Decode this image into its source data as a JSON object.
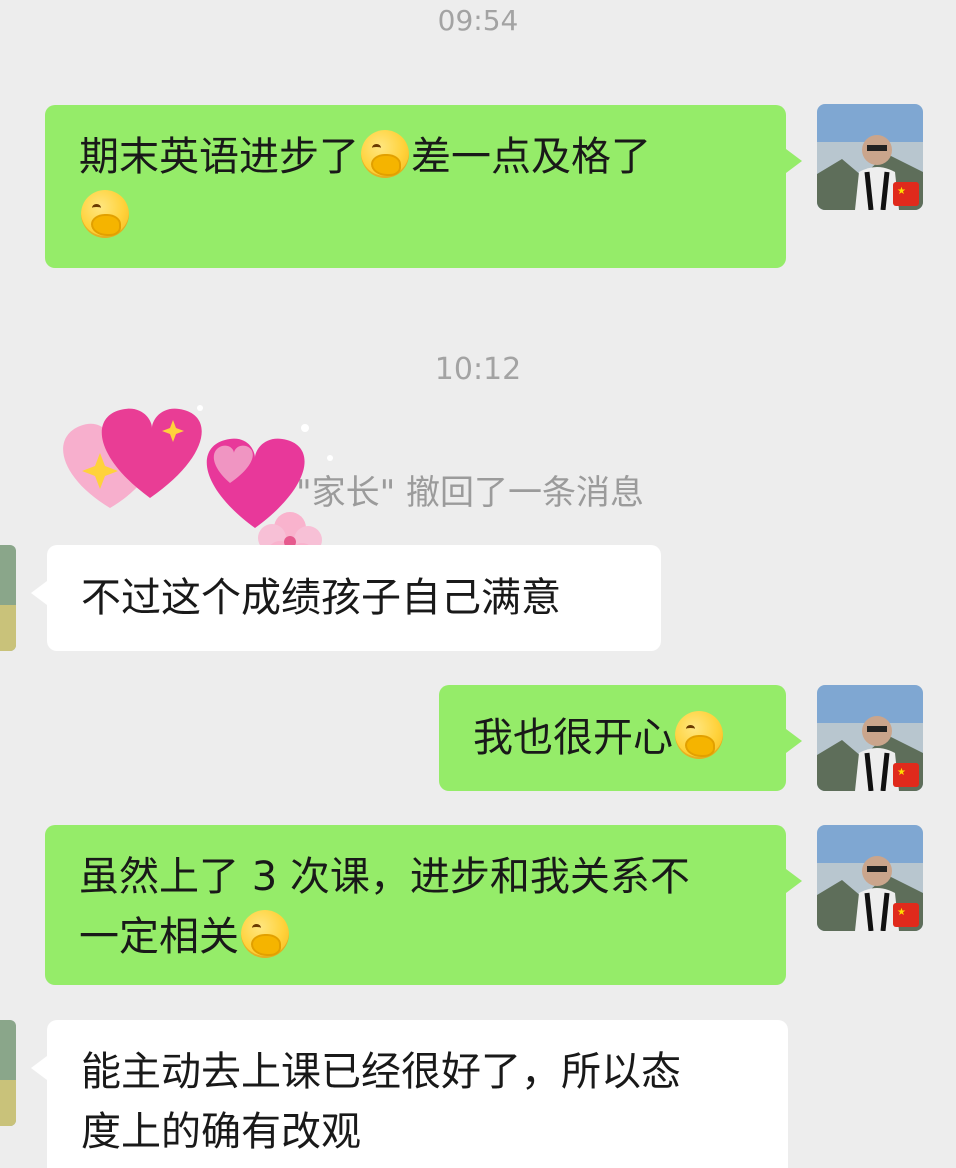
{
  "timestamps": {
    "t1": "09:54",
    "t2": "10:12"
  },
  "system": {
    "recall_text": "\"家长\" 撤回了一条消息"
  },
  "messages": [
    {
      "side": "right",
      "segments": [
        "期末英语进步了",
        "差一点及格了",
        ""
      ],
      "emoji": "face-with-hand-over-mouth"
    },
    {
      "side": "left",
      "text": "不过这个成绩孩子自己满意"
    },
    {
      "side": "right",
      "segments": [
        "我也很开心"
      ],
      "emoji": "face-with-hand-over-mouth"
    },
    {
      "side": "right",
      "segments": [
        "虽然上了 3 次课，进步和我关系不",
        "一定相关"
      ],
      "emoji": "face-with-hand-over-mouth"
    },
    {
      "side": "left",
      "segments": [
        "能主动去上课已经很好了，所以态",
        "度上的确有改观"
      ]
    }
  ],
  "colors": {
    "background": "#ededed",
    "self_bubble": "#95ec69",
    "other_bubble": "#ffffff",
    "meta_text": "#a3a3a3"
  },
  "icons": [
    "face-with-hand-over-mouth-emoji",
    "heart-sticker-icon",
    "sparkle-icon",
    "flower-sticker-icon",
    "china-flag-icon"
  ]
}
